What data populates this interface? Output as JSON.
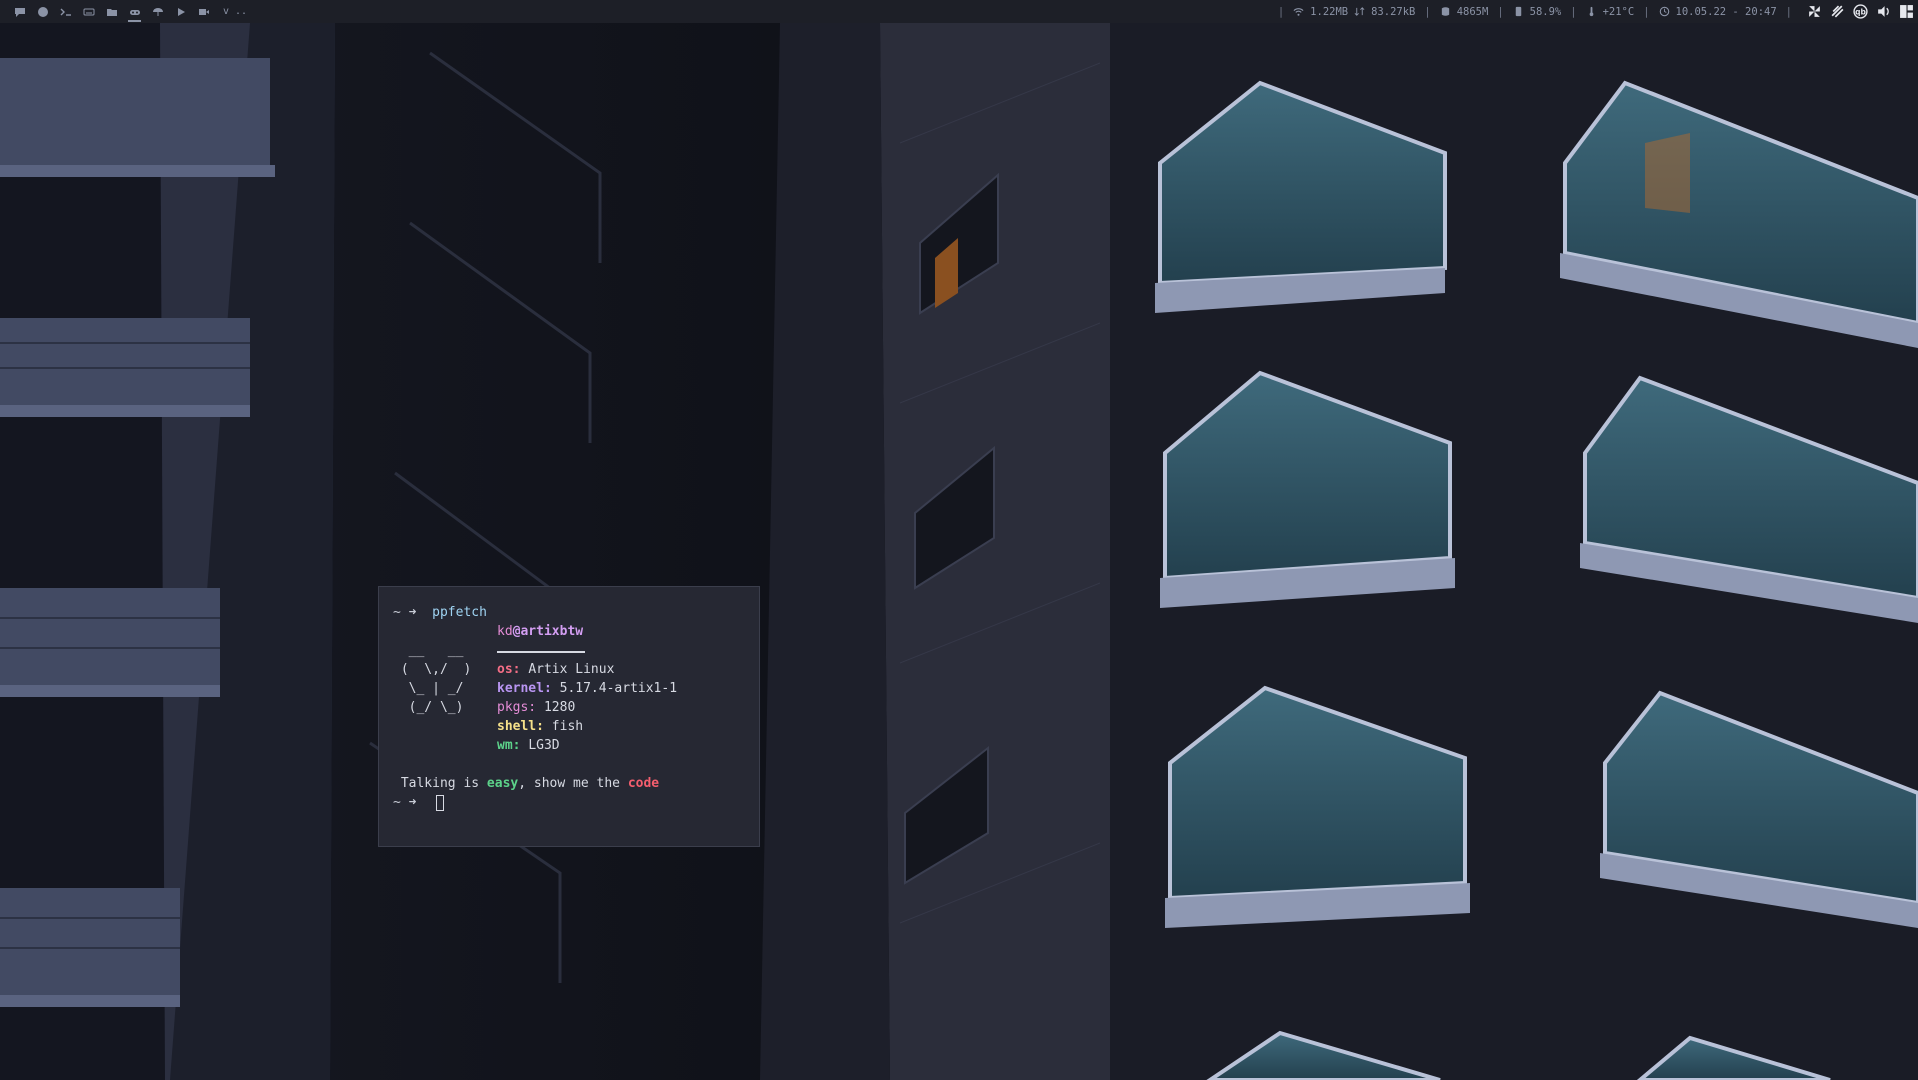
{
  "topbar": {
    "workspaces": [
      {
        "name": "chat-icon",
        "active": false
      },
      {
        "name": "firefox-icon",
        "active": false
      },
      {
        "name": "terminal-icon",
        "active": false
      },
      {
        "name": "keyboard-icon",
        "active": false
      },
      {
        "name": "folder-icon",
        "active": false
      },
      {
        "name": "gamepad-icon",
        "active": true
      },
      {
        "name": "umbrella-icon",
        "active": false
      },
      {
        "name": "play-icon",
        "active": false
      },
      {
        "name": "video-icon",
        "active": false
      }
    ],
    "extra": "v ..",
    "network": "1.22MB",
    "network_updown": "83.27kB",
    "memory": "4865M",
    "cpu": "58.9%",
    "temperature": "+21°C",
    "datetime": "10.05.22 - 20:47"
  },
  "terminal": {
    "prompt": "~ ➜",
    "command": "ppfetch",
    "user": "kd",
    "at": "@",
    "host": "artixbtw",
    "logo": [
      "  __   __",
      " (  \\,/  )",
      "  \\_ | _/",
      "  (_/ \\_)"
    ],
    "info": [
      {
        "key": "os:",
        "value": "Artix Linux",
        "cls": "k-os"
      },
      {
        "key": "kernel:",
        "value": "5.17.4-artix1-1",
        "cls": "k-kernel"
      },
      {
        "key": "pkgs:",
        "value": "1280",
        "cls": "k-pkgs"
      },
      {
        "key": "shell:",
        "value": "fish",
        "cls": "k-shell"
      },
      {
        "key": "wm:",
        "value": "LG3D",
        "cls": "k-wm"
      }
    ],
    "quote_a": "Talking is ",
    "quote_easy": "easy",
    "quote_b": ", show me the ",
    "quote_code": "code"
  }
}
